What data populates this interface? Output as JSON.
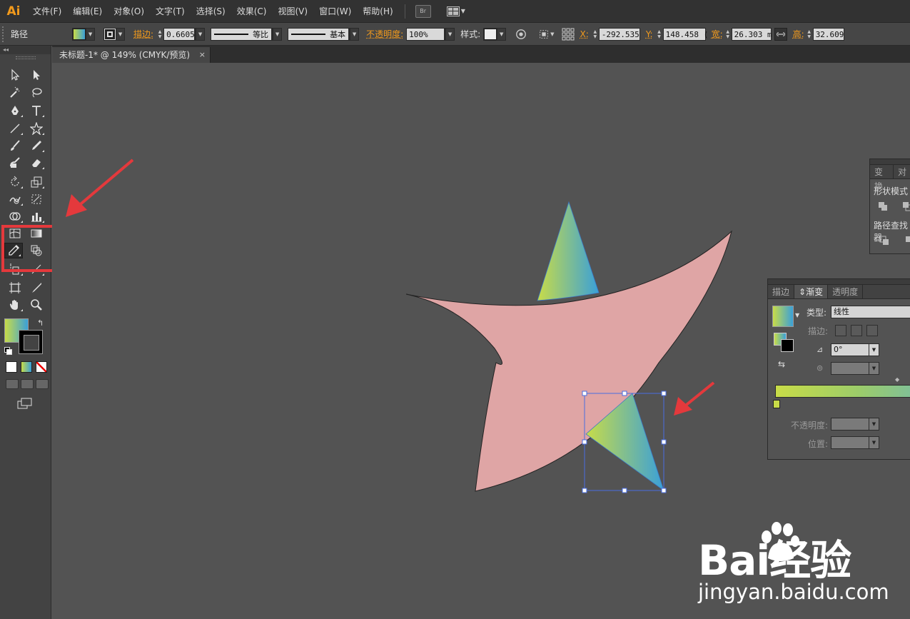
{
  "app": {
    "logo": "Ai"
  },
  "menu": {
    "items": [
      "文件(F)",
      "编辑(E)",
      "对象(O)",
      "文字(T)",
      "选择(S)",
      "效果(C)",
      "视图(V)",
      "窗口(W)",
      "帮助(H)"
    ],
    "bridge_label": "Br"
  },
  "control": {
    "object_type": "路径",
    "stroke_label": "描边:",
    "stroke_value": "0.6605",
    "profile_label": "等比",
    "brush_label": "基本",
    "opacity_label": "不透明度:",
    "opacity_value": "100%",
    "style_label": "样式:",
    "x_label": "X:",
    "x_value": "-292.535",
    "y_label": "Y:",
    "y_value": "148.458 (",
    "w_label": "宽:",
    "w_value": "26.303 m",
    "h_label": "高:",
    "h_value": "32.609"
  },
  "document": {
    "tab_title": "未标题-1* @ 149% (CMYK/预览)",
    "close": "×"
  },
  "pathfinder_panel": {
    "tabs": [
      "变换",
      "对"
    ],
    "shape_modes": "形状模式",
    "pathfinder": "路径查找器"
  },
  "gradient_panel": {
    "tabs": [
      "描边",
      "渐变",
      "透明度"
    ],
    "type_label": "类型:",
    "type_value": "线性",
    "stroke_label": "描边:",
    "angle_value": "0°",
    "opacity_label": "不透明度:",
    "location_label": "位置:"
  },
  "colors": {
    "accent": "#f29a1c",
    "highlight_red": "#e4393c",
    "gradient_start": "#c8dc48",
    "gradient_end": "#3aa0d8",
    "star_fill": "#dfa5a5"
  },
  "watermark": {
    "logo": "Bai经验",
    "url": "jingyan.baidu.com"
  }
}
